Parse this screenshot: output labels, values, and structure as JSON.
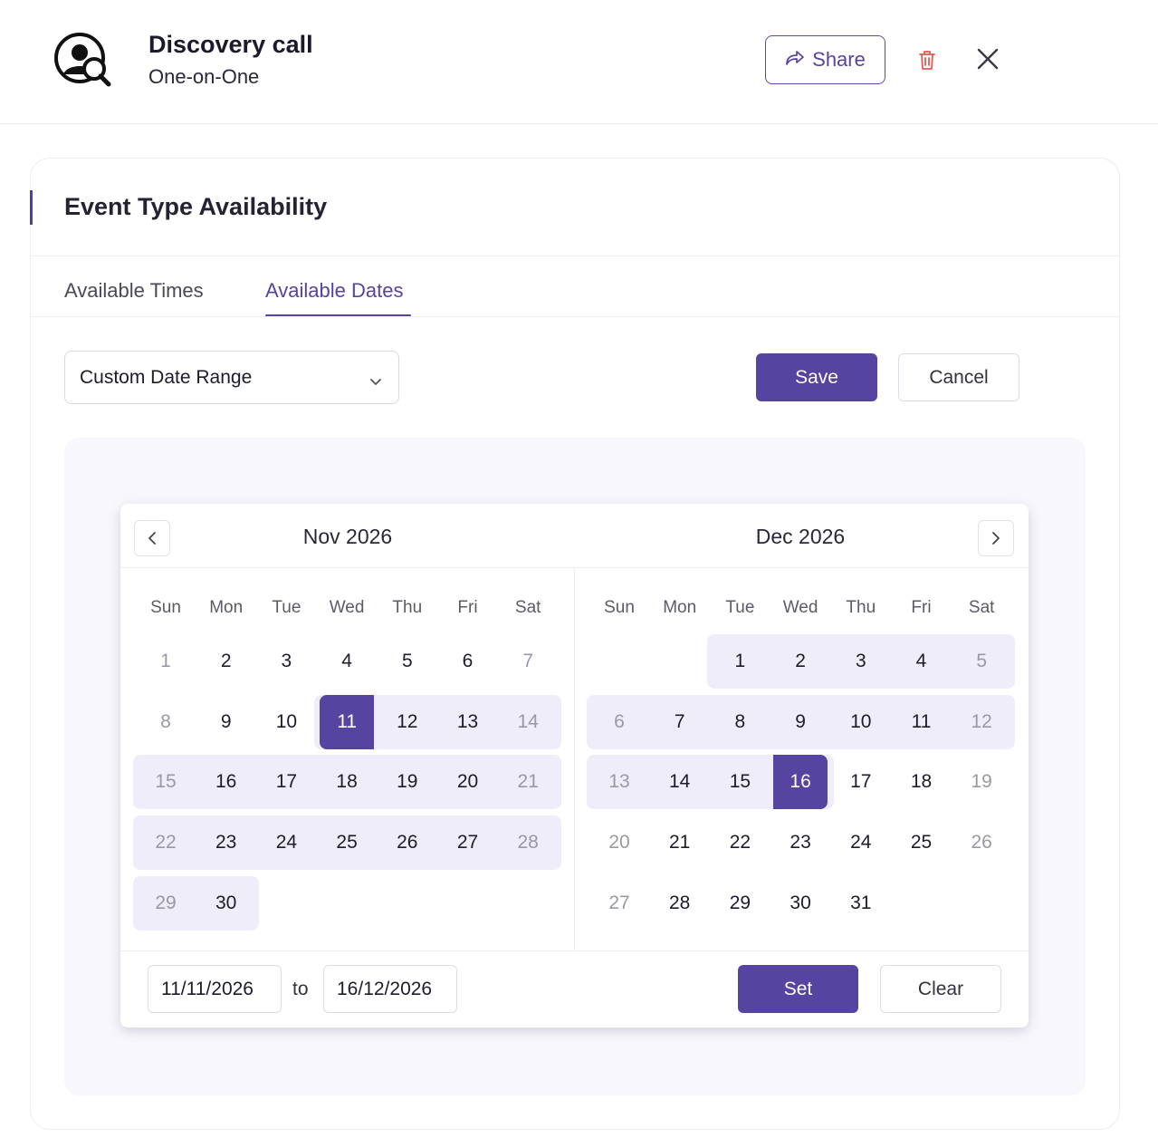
{
  "header": {
    "title": "Discovery call",
    "subtitle": "One-on-One",
    "share_label": "Share",
    "icons": {
      "avatar": "user-search-icon",
      "share": "share-arrow-icon",
      "delete": "trash-icon",
      "close": "close-icon"
    }
  },
  "card": {
    "title": "Event Type Availability",
    "tabs": [
      {
        "label": "Available Times",
        "active": false
      },
      {
        "label": "Available Dates",
        "active": true
      }
    ],
    "range_select": {
      "value": "Custom Date Range"
    },
    "save_label": "Save",
    "cancel_label": "Cancel"
  },
  "calendar": {
    "weekdays": [
      "Sun",
      "Mon",
      "Tue",
      "Wed",
      "Thu",
      "Fri",
      "Sat"
    ],
    "months": [
      {
        "title": "Nov 2026",
        "first_weekday": 0,
        "days_in_month": 30
      },
      {
        "title": "Dec 2026",
        "first_weekday": 2,
        "days_in_month": 31
      }
    ],
    "range_start": {
      "month": 0,
      "day": 11
    },
    "range_end": {
      "month": 1,
      "day": 16
    },
    "from_value": "11/11/2026",
    "to_label": "to",
    "to_value": "16/12/2026",
    "set_label": "Set",
    "clear_label": "Clear"
  },
  "colors": {
    "accent": "#5544a0",
    "range_bg": "#eeedf9"
  }
}
